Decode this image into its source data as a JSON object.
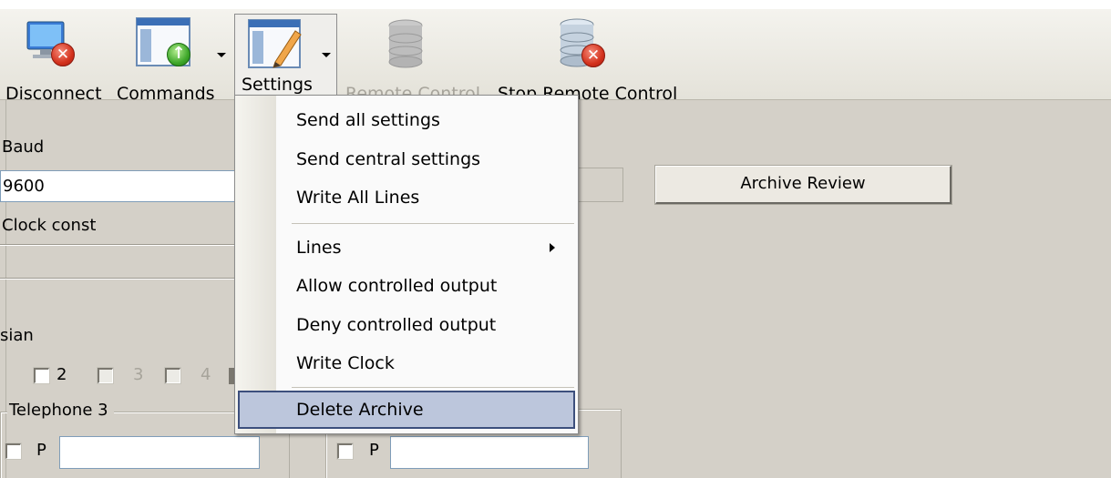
{
  "toolbar": {
    "buttons": [
      {
        "label": "Disconnect",
        "icon": "monitor-disconnect-icon",
        "enabled": true
      },
      {
        "label": "Commands",
        "icon": "window-upload-icon",
        "enabled": true,
        "has_dropdown": true
      },
      {
        "label": "Settings",
        "icon": "window-edit-icon",
        "enabled": true,
        "has_dropdown": true,
        "pressed": true
      },
      {
        "label": "Remote Control",
        "icon": "database-remote-icon",
        "enabled": false
      },
      {
        "label": "Stop Remote Control",
        "icon": "database-stop-icon",
        "enabled": true
      }
    ]
  },
  "form": {
    "baud_label": "Baud",
    "baud_value": "9600",
    "clock_const_label": "Clock const",
    "sian_label": "sian",
    "checks": [
      "2",
      "3",
      "4"
    ],
    "telephone3_label": "Telephone 3",
    "p_label_left": "P",
    "p_label_right": "P",
    "archive_review_button": "Archive Review"
  },
  "settings_menu": {
    "items": [
      {
        "label": "Send all settings"
      },
      {
        "label": "Send central settings"
      },
      {
        "label": "Write All Lines"
      },
      {
        "label": "Lines",
        "has_submenu": true
      },
      {
        "label": "Allow controlled output"
      },
      {
        "label": "Deny controlled output"
      },
      {
        "label": "Write Clock"
      },
      {
        "label": "Delete Archive",
        "highlighted": true
      }
    ]
  },
  "colors": {
    "menu_highlight": "#bcc6dc",
    "menu_highlight_border": "#3c4f7d",
    "window_bg": "#d4d0c8",
    "close_badge": "#d3321d",
    "upload_badge": "#3fa82b"
  }
}
